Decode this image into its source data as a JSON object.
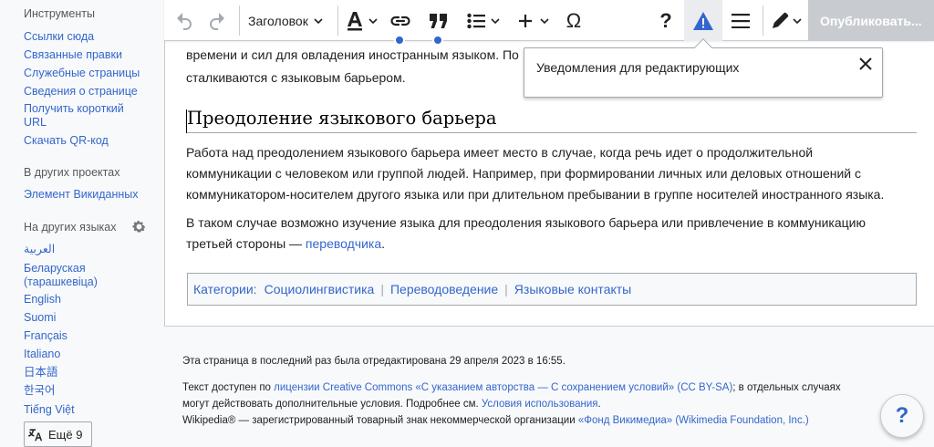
{
  "sidebar": {
    "tools_heading": "Инструменты",
    "tools": [
      "Ссылки сюда",
      "Связанные правки",
      "Служебные страницы",
      "Сведения о странице",
      "Получить короткий URL",
      "Скачать QR-код"
    ],
    "other_projects_heading": "В других проектах",
    "other_projects": [
      "Элемент Викиданных"
    ],
    "languages_heading": "На других языках",
    "languages": [
      "العربية",
      "Беларуская (тарашкевіца)",
      "English",
      "Suomi",
      "Français",
      "Italiano",
      "日本語",
      "한국어",
      "Tiếng Việt"
    ],
    "more_languages": "Ещё 9"
  },
  "toolbar": {
    "heading_select": "Заголовок",
    "publish": "Опубликовать...",
    "icons": [
      "undo-icon",
      "redo-icon",
      "text-style-icon",
      "link-icon",
      "quote-icon",
      "list-icon",
      "insert-icon",
      "special-char-icon",
      "help-icon",
      "warning-icon",
      "menu-icon",
      "edit-mode-icon"
    ]
  },
  "popup": {
    "title": "Уведомления для редактирующих"
  },
  "content": {
    "top_line1": "времени и сил для овладения иностранным языком. По",
    "top_line2": "сталкиваются с языковым барьером.",
    "section_heading": "Преодоление языкового барьера",
    "p1_line1": "Работа над преодолением языкового барьера имеет место в случае, когда речь идет о продолжительной",
    "p1_line2": "коммуникации с человеком или группой людей. Например, при формировании личных или деловых отношений с",
    "p1_line3": "коммуникатором-носителем другого языка или при длительном пребывании в группе носителей иностранного языка.",
    "p2_line1": "В таком случае возможно изучение языка для преодоления языкового барьера или привлечение в коммуникацию",
    "p2_line2_prefix": "третьей стороны — ",
    "p2_link": "переводчика",
    "p2_suffix": ".",
    "categories_label": "Категории:",
    "categories": [
      "Социолингвистика",
      "Переводоведение",
      "Языковые контакты"
    ]
  },
  "footer": {
    "last_edited": "Эта страница в последний раз была отредактирована 29 апреля 2023 в 16:55.",
    "license_prefix": "Текст доступен по ",
    "license_link": "лицензии Creative Commons «С указанием авторства — С сохранением условий» (CC BY-SA)",
    "license_suffix": "; в отдельных случаях",
    "license_line2_prefix": "могут действовать дополнительные условия. Подробнее см. ",
    "terms_link": "Условия использования",
    "license_line2_suffix": ".",
    "trademark_prefix": "Wikipedia® — зарегистрированный товарный знак некоммерческой организации ",
    "foundation_link": "«Фонд Викимедиа» (Wikimedia Foundation, Inc.)"
  },
  "help_button": "?",
  "colors": {
    "link": "#3366cc",
    "border": "#a2a9b1",
    "publish_disabled": "#c8ccd1",
    "warning": "#3366cc"
  }
}
